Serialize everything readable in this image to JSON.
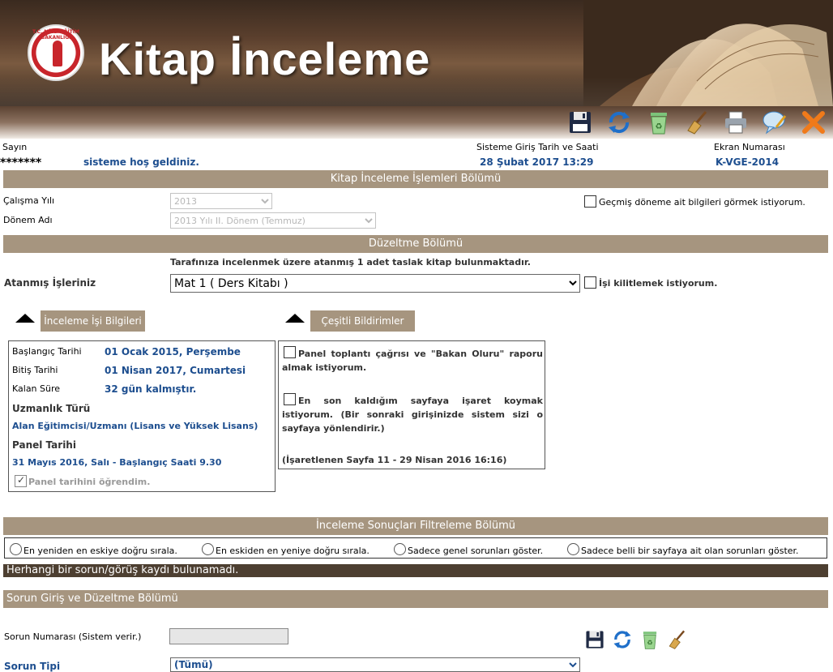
{
  "banner": {
    "title": "Kitap İnceleme",
    "logo_text": "T.C. MİLLÎ EĞİTİM BAKANLIĞI"
  },
  "toolbar": {
    "icons": [
      "save-icon",
      "refresh-icon",
      "recycle-bin-icon",
      "broom-icon",
      "printer-icon",
      "chat-icon",
      "close-icon"
    ]
  },
  "welcome": {
    "sayin_label": "Sayın",
    "user_masked": "*******",
    "welcome_text": "sisteme hoş geldiniz.",
    "login_label": "Sisteme Giriş Tarih ve Saati",
    "login_value": "28 Şubat 2017 13:29",
    "screen_label": "Ekran Numarası",
    "screen_value": "K-VGE-2014"
  },
  "section1": {
    "title": "Kitap İnceleme İşlemleri Bölümü",
    "year_label": "Çalışma Yılı",
    "year_value": "2013",
    "term_label": "Dönem Adı",
    "term_value": "2013 Yılı II. Dönem (Temmuz)",
    "past_checkbox": "Geçmiş döneme ait bilgileri görmek istiyorum."
  },
  "section2": {
    "title": "Düzeltme Bölümü",
    "info_text": "Tarafınıza incelenmek üzere atanmış 1 adet taslak kitap bulunmaktadır.",
    "assigned_label": "Atanmış İşleriniz",
    "assigned_value": "Mat 1 ( Ders Kitabı )",
    "lock_checkbox": "İşi kilitlemek istiyorum."
  },
  "tabs": {
    "left": "İnceleme İşi Bilgileri",
    "right": "Çeşitli Bildirimler"
  },
  "info_box": {
    "start_label": "Başlangıç Tarihi",
    "start_value": "01 Ocak 2015, Perşembe",
    "end_label": "Bitiş Tarihi",
    "end_value": "01 Nisan 2017, Cumartesi",
    "remain_label": "Kalan Süre",
    "remain_value": "32 gün kalmıştır.",
    "expertise_label": "Uzmanlık Türü",
    "expertise_value": "Alan Eğitimcisi/Uzmanı (Lisans ve Yüksek Lisans)",
    "panel_label": "Panel Tarihi",
    "panel_value": "31 Mayıs 2016, Salı - Başlangıç Saati 9.30",
    "panel_checkbox": "Panel tarihini öğrendim."
  },
  "notices": {
    "n1": "Panel toplantı çağrısı ve \"Bakan Oluru\" raporu almak istiyorum.",
    "n2": "En son kaldığım sayfaya işaret koymak istiyorum. (Bir sonraki girişinizde sistem sizi o sayfaya yönlendirir.)",
    "n3": "(İşaretlenen Sayfa 11 - 29 Nisan 2016 16:16)"
  },
  "filter": {
    "title": "İnceleme Sonuçları Filtreleme Bölümü",
    "options": [
      "En yeniden en eskiye doğru sırala.",
      "En eskiden en yeniye doğru sırala.",
      "Sadece genel sorunları göster.",
      "Sadece belli bir sayfaya ait olan sorunları göster."
    ],
    "no_record": "Herhangi bir sorun/görüş kaydı bulunamadı."
  },
  "problem": {
    "title": "Sorun Giriş ve Düzeltme Bölümü",
    "number_label": "Sorun Numarası (Sistem verir.)",
    "type_label": "Sorun Tipi",
    "type_value": "(Tümü)"
  }
}
